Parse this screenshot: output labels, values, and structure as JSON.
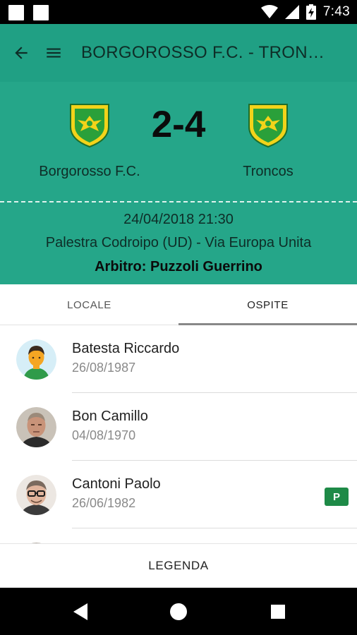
{
  "status_bar": {
    "time": "7:43",
    "icons": [
      "notification-square-icon",
      "notification-square-icon",
      "wifi-icon",
      "signal-icon",
      "battery-charging-icon"
    ]
  },
  "app_bar": {
    "title": "BORGOROSSO F.C. - TRONCOS",
    "icons": [
      "back-arrow-icon",
      "hamburger-menu-icon"
    ]
  },
  "match": {
    "home_team": "Borgorosso F.C.",
    "away_team": "Troncos",
    "score": "2-4",
    "datetime": "24/04/2018 21:30",
    "venue": "Palestra Codroipo (UD) - Via Europa Unita",
    "referee": "Arbitro: Puzzoli Guerrino",
    "crest_icon": "team-crest-icon"
  },
  "tabs": [
    {
      "label": "LOCALE",
      "selected": false
    },
    {
      "label": "OSPITE",
      "selected": true
    }
  ],
  "players": [
    {
      "name": "Batesta Riccardo",
      "dob": "26/08/1987",
      "badge": "",
      "avatar": "cartoon-avatar"
    },
    {
      "name": "Bon Camillo",
      "dob": "04/08/1970",
      "badge": "",
      "avatar": "photo-avatar"
    },
    {
      "name": "Cantoni Paolo",
      "dob": "26/06/1982",
      "badge": "P",
      "avatar": "photo-avatar"
    }
  ],
  "legend_button": "LEGENDA",
  "nav_bar": {
    "icons": [
      "nav-back-icon",
      "nav-home-icon",
      "nav-recents-icon"
    ]
  },
  "colors": {
    "app_bar": "#20a084",
    "header": "#25a689",
    "badge": "#1e8a47"
  }
}
